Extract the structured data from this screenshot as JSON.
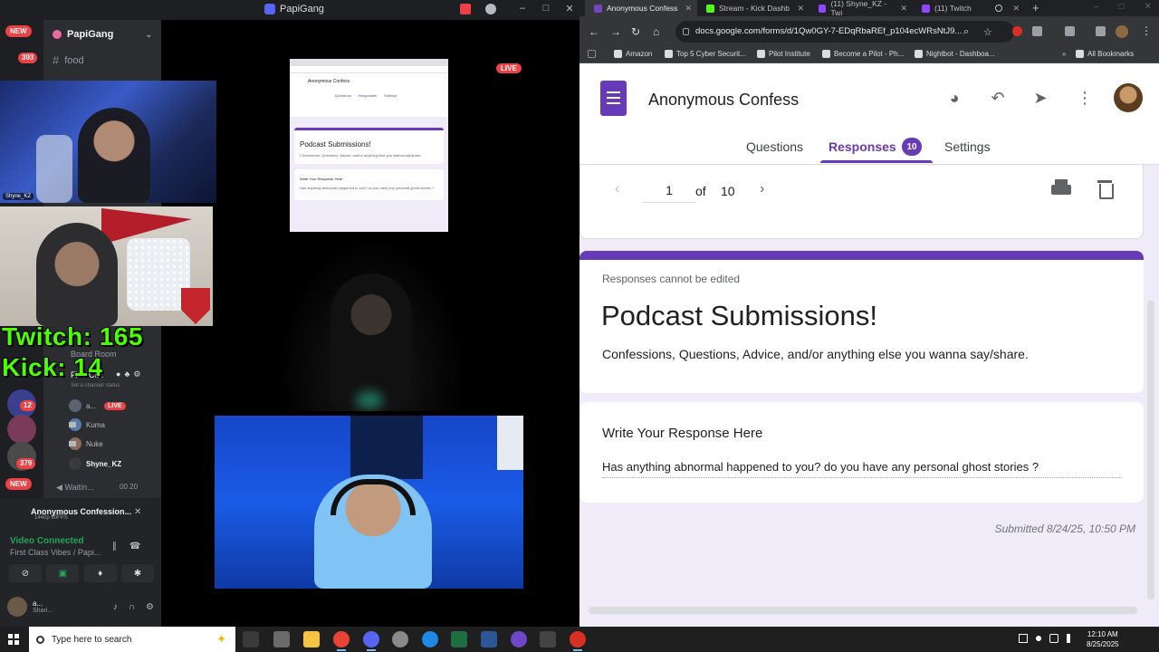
{
  "discord": {
    "window_title": "PapiGang",
    "server_name": "PapiGang",
    "channels": [
      {
        "label": "food"
      }
    ],
    "badges": {
      "new_top": "NEW",
      "count_393": "393",
      "count_12": "12",
      "count_379": "379",
      "new_bottom": "NEW"
    },
    "voice": {
      "board_room": "Board Room",
      "first_class": "First Cl...",
      "set_status": "Set a channel status",
      "waiting": "Waitin...",
      "waiting_counts": "00  20",
      "users": [
        {
          "name": "a...",
          "live": "LIVE"
        },
        {
          "name": "Kuma"
        },
        {
          "name": "Nuke"
        },
        {
          "name": "Shyne_KZ"
        }
      ]
    },
    "stream": {
      "title": "Anonymous Confession...",
      "sub": "1440p 60FPS",
      "connected": "Video Connected",
      "channel": "First Class Vibes / Papi..."
    },
    "user": {
      "name": "a...",
      "status": "Shari..."
    },
    "live_label": "LIVE",
    "counters": {
      "twitch": "Twitch: 165",
      "kick": "Kick: 14"
    },
    "cam_tag": "Shyne_KZ",
    "mini_form": {
      "title": "Anonymous Confess",
      "tabs": [
        "Questions",
        "Responses",
        "Settings"
      ],
      "heading": "Podcast Submissions!",
      "desc": "Confessions, Questions, Advice, and/or anything else you wanna say/share.",
      "q": "Write Your Response Here",
      "a": "Has anything abnormal happened to you? do you have any personal ghost stories ?"
    }
  },
  "chrome": {
    "tabs": [
      {
        "label": "Anonymous Confess",
        "color": "#7248b9"
      },
      {
        "label": "Stream - Kick Dashb",
        "color": "#53fc18"
      },
      {
        "label": "(11) Shyne_KZ - Twi",
        "color": "#9146ff"
      },
      {
        "label": "(11) Twitch",
        "color": "#9146ff"
      }
    ],
    "url": "docs.google.com/forms/d/1Qw0GY-7-EDqRbaREf_p104ecWRsNtJ9...",
    "bookmarks": [
      {
        "label": "Amazon"
      },
      {
        "label": "Top 5 Cyber Securit..."
      },
      {
        "label": "Pilot Institute"
      },
      {
        "label": "Become a Pilot - Ph..."
      },
      {
        "label": "Nightbot - Dashboa..."
      }
    ],
    "all_bookmarks": "All Bookmarks"
  },
  "form": {
    "title": "Anonymous Confess",
    "tabs": {
      "questions": "Questions",
      "responses": "Responses",
      "responses_count": "10",
      "settings": "Settings"
    },
    "pager": {
      "current": "1",
      "of": "of",
      "total": "10"
    },
    "note": "Responses cannot be edited",
    "heading": "Podcast Submissions!",
    "description": "Confessions, Questions, Advice, and/or anything else you wanna say/share.",
    "question": "Write Your Response Here",
    "answer": "Has anything abnormal happened to you? do you have any personal ghost stories ?",
    "submitted": "Submitted 8/24/25, 10:50 PM",
    "accent": "#673ab7"
  },
  "taskbar": {
    "search_placeholder": "Type here to search",
    "time": "12:10 AM",
    "date": "8/25/2025"
  }
}
